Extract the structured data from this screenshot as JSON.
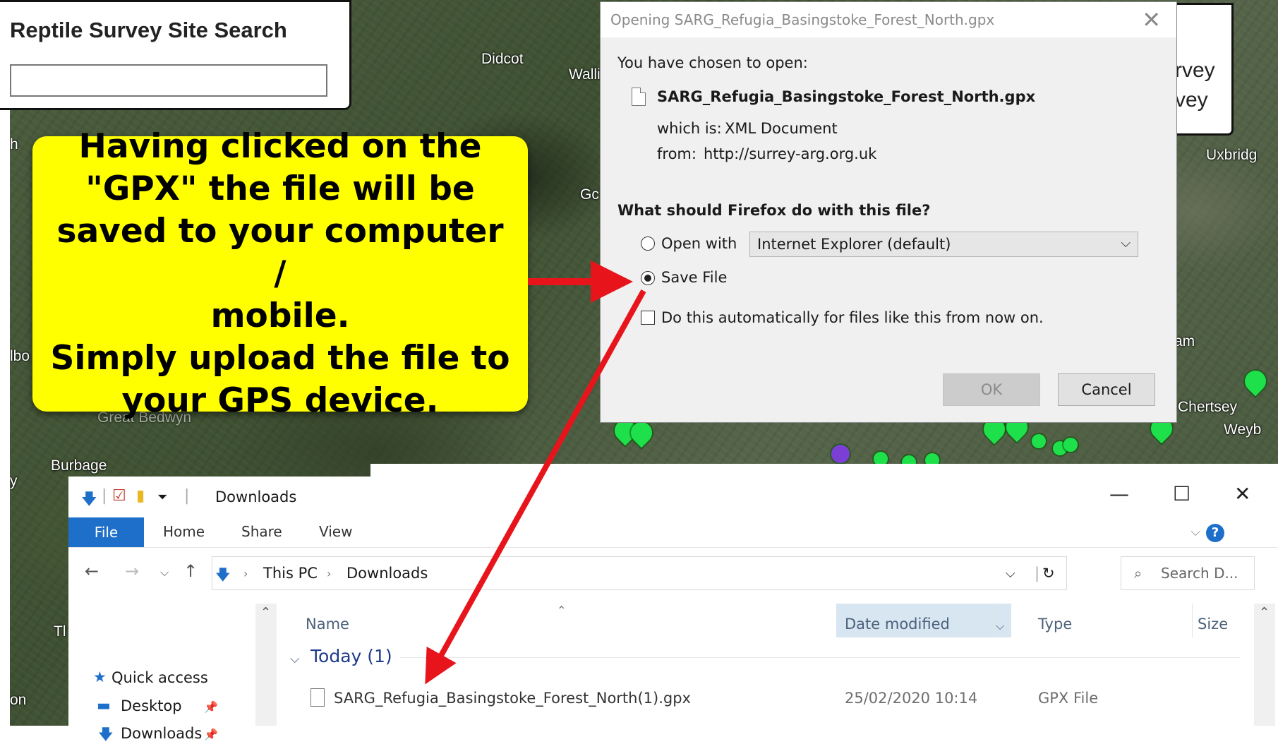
{
  "map": {
    "labels": [
      {
        "text": "Didcot"
      },
      {
        "text": "Walli"
      },
      {
        "text": "Gc"
      },
      {
        "text": "Burbage"
      },
      {
        "text": "Great Bedwyn"
      },
      {
        "text": "Uxbridg"
      },
      {
        "text": "am"
      },
      {
        "text": "Chertsey"
      },
      {
        "text": "Weyb"
      },
      {
        "text": "lbo"
      },
      {
        "text": "y"
      },
      {
        "text": "Tl"
      },
      {
        "text": "on"
      },
      {
        "text": "h"
      }
    ]
  },
  "search_panel": {
    "title": "Reptile Survey Site Search",
    "input_value": ""
  },
  "right_panel": {
    "line1": "rvey",
    "line2": "vey"
  },
  "callout": {
    "lines": [
      "Having clicked on the",
      "\"GPX\" the file will be",
      "saved to your computer /",
      "mobile.",
      "Simply upload the file to",
      "your GPS device."
    ],
    "background": "#ffff00"
  },
  "dialog": {
    "title": "Opening SARG_Refugia_Basingstoke_Forest_North.gpx",
    "intro": "You have chosen to open:",
    "filename": "SARG_Refugia_Basingstoke_Forest_North.gpx",
    "which_is_label": "which is:",
    "which_is_value": "XML Document",
    "from_label": "from:",
    "from_value": "http://surrey-arg.org.uk",
    "question": "What should Firefox do with this file?",
    "open_with_label": "Open with",
    "open_with_value": "Internet Explorer (default)",
    "save_file_label": "Save File",
    "save_file_selected": true,
    "auto_label": "Do this automatically for files like this from now on.",
    "auto_checked": false,
    "ok_label": "OK",
    "cancel_label": "Cancel"
  },
  "explorer": {
    "title": "Downloads",
    "ribbon_tabs": [
      "File",
      "Home",
      "Share",
      "View"
    ],
    "address": {
      "root": "This PC",
      "current": "Downloads"
    },
    "search_placeholder": "Search D...",
    "sidebar": [
      {
        "label": "Quick access",
        "icon": "star-icon"
      },
      {
        "label": "Desktop",
        "icon": "desktop-icon",
        "pinned": true
      },
      {
        "label": "Downloads",
        "icon": "download-icon",
        "pinned": true
      }
    ],
    "columns": {
      "name": "Name",
      "date": "Date modified",
      "type": "Type",
      "size": "Size"
    },
    "group_label": "Today (1)",
    "rows": [
      {
        "name": "SARG_Refugia_Basingstoke_Forest_North(1).gpx",
        "date": "25/02/2020 10:14",
        "type": "GPX File",
        "size": ""
      }
    ]
  },
  "colors": {
    "arrow": "#e8141c",
    "accent": "#1e6fc9",
    "pin_green": "#1ee04a",
    "pin_purple": "#7b3fd6"
  }
}
